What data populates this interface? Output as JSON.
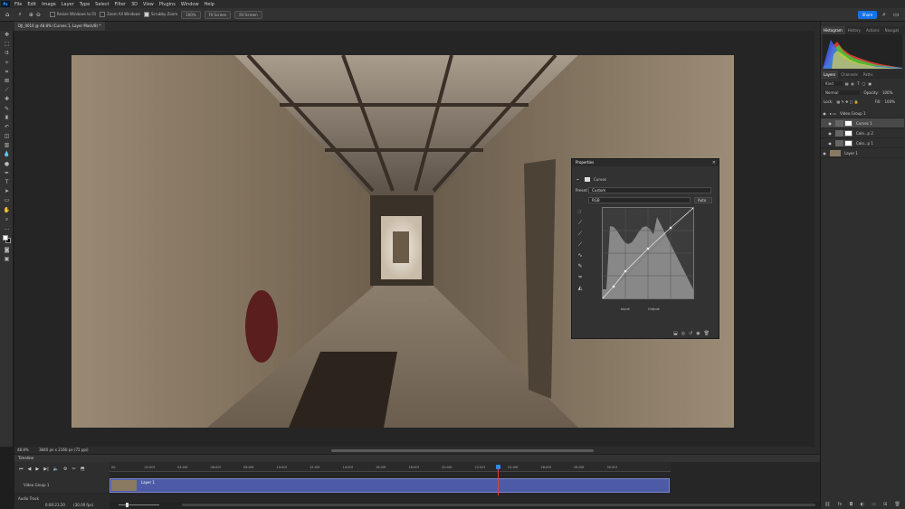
{
  "menu": {
    "logo": "Ps",
    "items": [
      "File",
      "Edit",
      "Image",
      "Layer",
      "Type",
      "Select",
      "Filter",
      "3D",
      "View",
      "Plugins",
      "Window",
      "Help"
    ]
  },
  "options": {
    "resize": "Resize Windows to Fit",
    "zoom_all": "Zoom All Windows",
    "scrubby": "Scrubby Zoom",
    "pct": "100%",
    "fit": "Fit Screen",
    "fill": "Fill Screen",
    "share": "Share"
  },
  "doc": {
    "tab": "DJI_0016 @ 48.8% (Curves 1, Layer Mask/8) *",
    "zoom": "48.8%",
    "size": "3840 px x 2160 px (72 ppi)"
  },
  "tools": [
    "move-icon",
    "marquee-icon",
    "lasso-icon",
    "quick-select-icon",
    "crop-icon",
    "frame-icon",
    "eyedropper-icon",
    "heal-icon",
    "brush-icon",
    "stamp-icon",
    "history-brush-icon",
    "eraser-icon",
    "gradient-icon",
    "blur-icon",
    "dodge-icon",
    "pen-icon",
    "type-icon",
    "path-select-icon",
    "shape-icon",
    "hand-icon",
    "zoom-icon",
    "more-icon"
  ],
  "properties": {
    "title": "Properties",
    "adjust": "Curves",
    "preset_label": "Preset:",
    "preset": "Custom",
    "channel": "RGB",
    "auto": "Auto",
    "input": "Input:",
    "output": "Output:"
  },
  "right": {
    "top_tabs": [
      "Histogram",
      "History",
      "Actions",
      "Navigat"
    ],
    "layer_tabs": [
      "Layers",
      "Channels",
      "Paths"
    ],
    "kind": "Kind",
    "blend": "Normal",
    "opacity_label": "Opacity:",
    "opacity": "100%",
    "lock_label": "Lock:",
    "fill_label": "Fill:",
    "fill": "100%"
  },
  "layers": [
    {
      "name": "Video Group 1",
      "kind": "group"
    },
    {
      "name": "Curves 1",
      "kind": "adj",
      "selected": true
    },
    {
      "name": "Colo...p 2",
      "kind": "adj"
    },
    {
      "name": "Colo...p 1",
      "kind": "adj"
    },
    {
      "name": "Layer 1",
      "kind": "video"
    }
  ],
  "timeline": {
    "title": "Timeline",
    "time": "0:00:21:20",
    "fps": "(30.00 fps)",
    "group": "Video Group 1",
    "audio": "Audio Track",
    "clip": "Layer 1",
    "ticks": [
      "00",
      "02:00f",
      "04:00f",
      "06:00f",
      "08:00f",
      "10:00f",
      "12:00f",
      "14:00f",
      "16:00f",
      "18:00f",
      "20:00f",
      "22:00f",
      "24:00f",
      "26:00f",
      "28:00f",
      "30:00f"
    ]
  },
  "curve_points": [
    [
      0,
      0
    ],
    [
      0.12,
      0.13
    ],
    [
      0.25,
      0.3
    ],
    [
      0.5,
      0.55
    ],
    [
      0.75,
      0.78
    ],
    [
      1,
      1
    ]
  ]
}
